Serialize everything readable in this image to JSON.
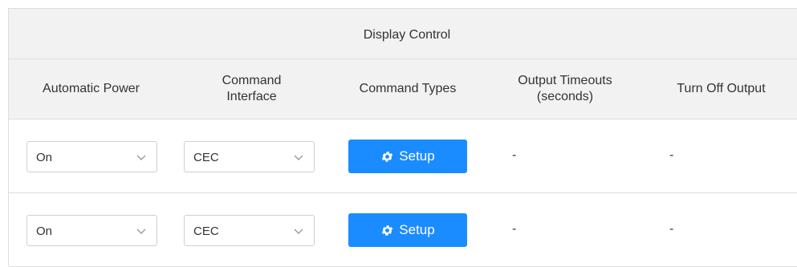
{
  "table": {
    "group_title": "Display Control",
    "columns": [
      {
        "line1": "Automatic Power",
        "line2": ""
      },
      {
        "line1": "Command",
        "line2": "Interface"
      },
      {
        "line1": "Command Types",
        "line2": ""
      },
      {
        "line1": "Output Timeouts",
        "line2": "(seconds)"
      },
      {
        "line1": "Turn Off Output",
        "line2": ""
      }
    ],
    "rows": [
      {
        "automatic_power": "On",
        "command_interface": "CEC",
        "setup_label": "Setup",
        "output_timeouts": "-",
        "turn_off_output": "-"
      },
      {
        "automatic_power": "On",
        "command_interface": "CEC",
        "setup_label": "Setup",
        "output_timeouts": "-",
        "turn_off_output": "-"
      }
    ]
  },
  "colors": {
    "header_bg": "#f2f2f2",
    "accent_button": "#1a8cff",
    "border": "#dcdcdc"
  },
  "icons": {
    "select_caret": "chevron-down-icon",
    "setup_button": "gear-icon"
  }
}
